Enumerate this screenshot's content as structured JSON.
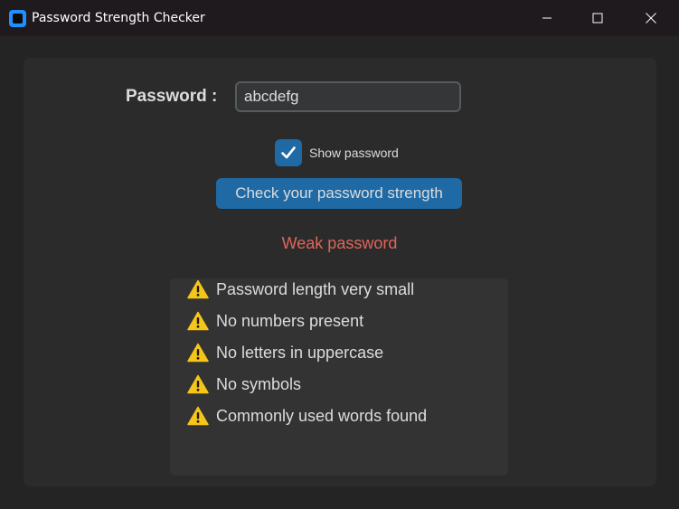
{
  "window": {
    "title": "Password Strength Checker"
  },
  "form": {
    "password_label": "Password :",
    "password_value": "abcdefg",
    "show_password_label": "Show password",
    "show_password_checked": true,
    "check_button_label": "Check your password strength"
  },
  "result": {
    "text": "Weak password",
    "color": "#e0655a"
  },
  "issues": [
    {
      "icon": "warning-icon",
      "text": "Password length very small"
    },
    {
      "icon": "warning-icon",
      "text": "No numbers present"
    },
    {
      "icon": "warning-icon",
      "text": "No letters in uppercase"
    },
    {
      "icon": "warning-icon",
      "text": "No symbols"
    },
    {
      "icon": "warning-icon",
      "text": "Commonly used words found"
    }
  ],
  "colors": {
    "accent": "#1f6aa5",
    "warning": "#f5c518"
  }
}
